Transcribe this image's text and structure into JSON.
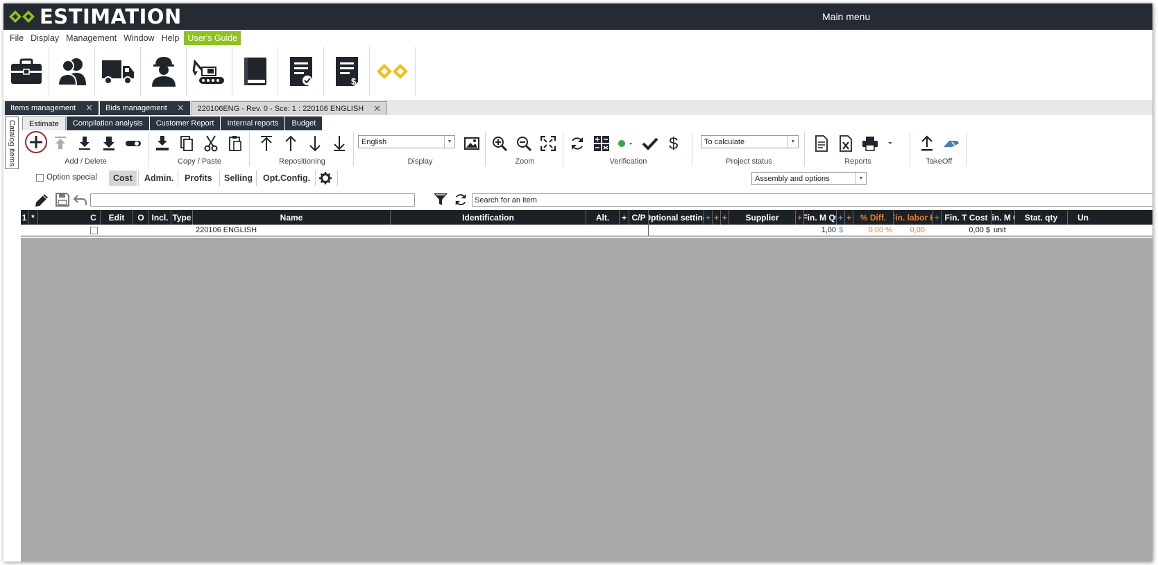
{
  "app": {
    "logo_text": "ESTIMATION",
    "window_title": "Main menu"
  },
  "menu": {
    "items": [
      "File",
      "Display",
      "Management",
      "Window",
      "Help"
    ],
    "guide": "User's Guide"
  },
  "ribbon_icons": [
    "briefcase-icon",
    "contacts-icon",
    "truck-icon",
    "worker-icon",
    "excavator-icon",
    "book-icon",
    "document-check-icon",
    "document-dollar-icon",
    "brand-logo-icon"
  ],
  "doc_tabs": [
    {
      "label": "Items management"
    },
    {
      "label": "Bids management"
    },
    {
      "label": "220106ENG - Rev. 0 - Sce: 1 : 220106 ENGLISH"
    }
  ],
  "side_tab": "Catalog items",
  "sub_tabs": [
    "Estimate",
    "Compilation analysis",
    "Customer Report",
    "Internal reports",
    "Budget"
  ],
  "toolbar": {
    "groups": {
      "add_delete": "Add / Delete",
      "copy_paste": "Copy / Paste",
      "repositioning": "Repositioning",
      "display": "Display",
      "zoom": "Zoom",
      "verification": "Verification",
      "project_status": "Project status",
      "reports": "Reports",
      "takeoff": "TakeOff"
    },
    "language": "English",
    "project_status_value": "To calculate"
  },
  "filters": {
    "option_special": "Option special",
    "pills": [
      "Cost",
      "Admin.",
      "Profits",
      "Selling",
      "Opt.Config."
    ],
    "view_mode": "Assembly and options"
  },
  "search": {
    "placeholder": "Search for an item"
  },
  "grid": {
    "headers": {
      "num": "1",
      "sort": "*",
      "c": "C",
      "edit": "Edit",
      "o": "O",
      "incl": "Incl.",
      "type": "Type",
      "name": "Name",
      "identification": "Identification",
      "alt": "Alt.",
      "plus1": "+",
      "cp": "C/P",
      "optional": "Optional setting",
      "p1": "+",
      "p2": "+",
      "p3": "+",
      "supplier": "Supplier",
      "p4": "+",
      "fin_m_qty": "Fin. M Qt",
      "p5": "+",
      "p6": "+",
      "pct_diff": "% Diff.",
      "fin_labor": "Fin. labor H",
      "p7": "+",
      "fin_t_cost": "Fin. T Cost",
      "fin_m_c": "Fin. M C",
      "stat_qty": "Stat. qty",
      "u": "Un"
    },
    "row": {
      "name": "220106 ENGLISH",
      "fin_m_qty": "1,00",
      "currency": "$",
      "pct_diff": "0,00 %",
      "fin_labor": "0,00",
      "fin_t_cost": "0,00 $",
      "unit": "unit"
    }
  },
  "colors": {
    "titlebar": "#242b33",
    "guide": "#8dc21f",
    "logo": "#f0c01c",
    "accent_orange": "#f07d1a",
    "accent_blue": "#2aa4e8",
    "accent_pink": "#e8358c",
    "accent_green": "#2fa84a"
  }
}
